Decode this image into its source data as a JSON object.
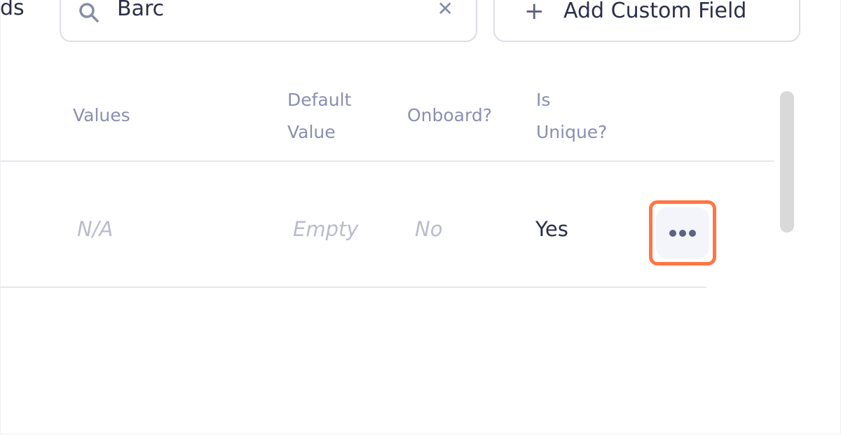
{
  "header": {
    "heading_fragment": "ds"
  },
  "search": {
    "value": "Barc",
    "icon": "search-icon",
    "clear_icon": "close-icon"
  },
  "add_button": {
    "label": "Add Custom Field",
    "icon": "plus-icon"
  },
  "table": {
    "columns": [
      {
        "line1": "Values",
        "line2": ""
      },
      {
        "line1": "Default",
        "line2": "Value"
      },
      {
        "line1": "Onboard?",
        "line2": ""
      },
      {
        "line1": "Is",
        "line2": "Unique?"
      }
    ],
    "rows": [
      {
        "values": "N/A",
        "default_value": "Empty",
        "onboard": "No",
        "is_unique": "Yes",
        "actions_icon": "more-horizontal-icon"
      }
    ]
  },
  "colors": {
    "highlight": "#ff7544",
    "header_text": "#8a8fb0",
    "muted_text": "#b9bccd"
  }
}
